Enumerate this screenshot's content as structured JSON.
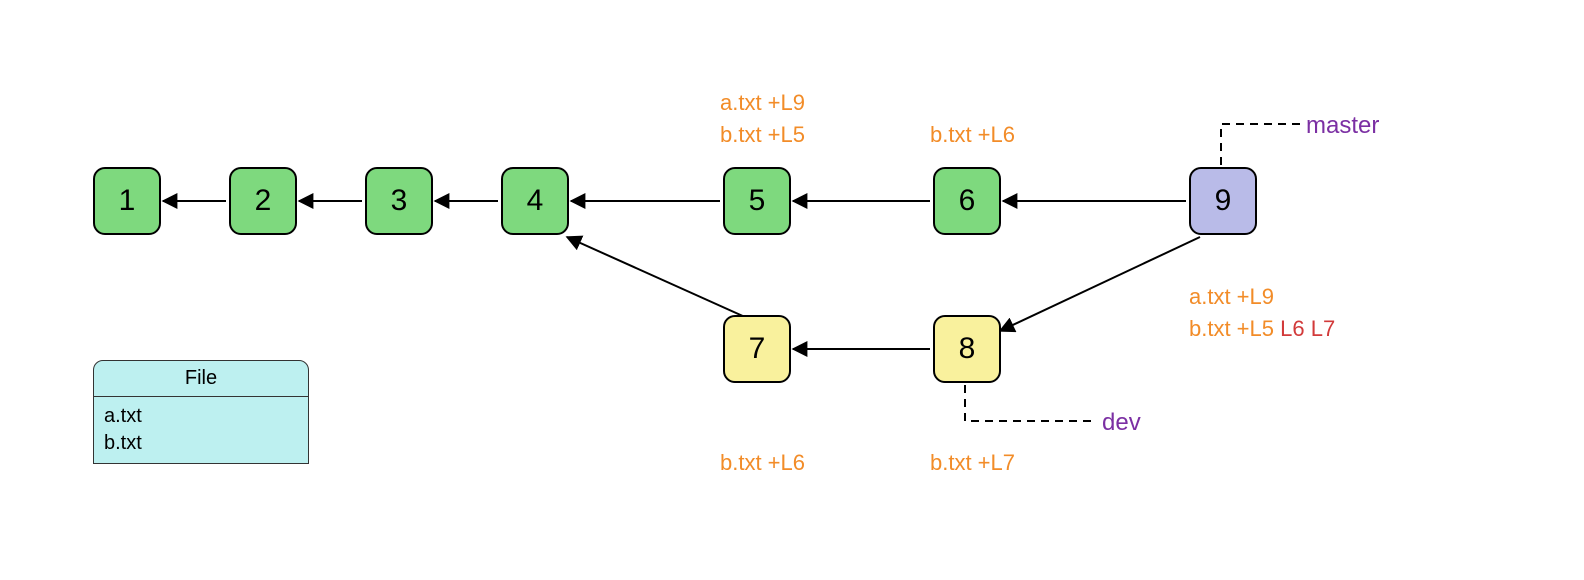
{
  "nodes": {
    "n1": {
      "label": "1"
    },
    "n2": {
      "label": "2"
    },
    "n3": {
      "label": "3"
    },
    "n4": {
      "label": "4"
    },
    "n5": {
      "label": "5"
    },
    "n6": {
      "label": "6"
    },
    "n7": {
      "label": "7"
    },
    "n8": {
      "label": "8"
    },
    "n9": {
      "label": "9"
    }
  },
  "annotations": {
    "c5l1": "a.txt +L9",
    "c5l2": "b.txt +L5",
    "c6": "b.txt +L6",
    "c7": "b.txt +L6",
    "c8": "b.txt +L7",
    "c9l1": "a.txt +L9",
    "c9l2a": "b.txt +L5 ",
    "c9l2b": "L6 ",
    "c9l2c": "L7"
  },
  "branches": {
    "master": "master",
    "dev": "dev"
  },
  "filebox": {
    "title": "File",
    "f1": "a.txt",
    "f2": "b.txt"
  },
  "chart_data": {
    "type": "graph",
    "description": "Git commit DAG with two branches merging",
    "nodes": [
      {
        "id": 1,
        "row": "main",
        "color": "green"
      },
      {
        "id": 2,
        "row": "main",
        "color": "green"
      },
      {
        "id": 3,
        "row": "main",
        "color": "green"
      },
      {
        "id": 4,
        "row": "main",
        "color": "green"
      },
      {
        "id": 5,
        "row": "main",
        "color": "green",
        "changes": [
          "a.txt +L9",
          "b.txt +L5"
        ]
      },
      {
        "id": 6,
        "row": "main",
        "color": "green",
        "changes": [
          "b.txt +L6"
        ]
      },
      {
        "id": 7,
        "row": "dev",
        "color": "yellow",
        "changes": [
          "b.txt +L6"
        ]
      },
      {
        "id": 8,
        "row": "dev",
        "color": "yellow",
        "changes": [
          "b.txt +L7"
        ]
      },
      {
        "id": 9,
        "row": "main",
        "color": "purple",
        "changes": [
          "a.txt +L9",
          "b.txt +L5 L6 L7"
        ],
        "conflict_lines": [
          "L6",
          "L7"
        ]
      }
    ],
    "edges": [
      {
        "from": 2,
        "to": 1
      },
      {
        "from": 3,
        "to": 2
      },
      {
        "from": 4,
        "to": 3
      },
      {
        "from": 5,
        "to": 4
      },
      {
        "from": 6,
        "to": 5
      },
      {
        "from": 9,
        "to": 6
      },
      {
        "from": 7,
        "to": 4
      },
      {
        "from": 8,
        "to": 7
      },
      {
        "from": 9,
        "to": 8
      }
    ],
    "branches": [
      {
        "name": "master",
        "points_to": 9
      },
      {
        "name": "dev",
        "points_to": 8
      }
    ],
    "files": [
      "a.txt",
      "b.txt"
    ]
  }
}
